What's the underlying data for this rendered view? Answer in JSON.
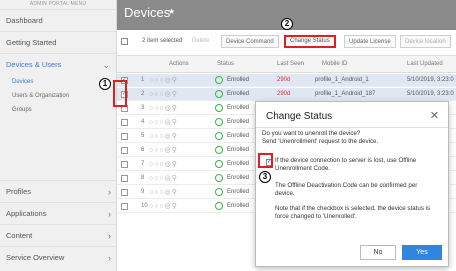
{
  "sidebar": {
    "header": "ADMIN PORTAL MENU",
    "items": [
      {
        "label": "Dashboard",
        "active": false
      },
      {
        "label": "Getting Started",
        "active": false
      },
      {
        "label": "Devices & Users",
        "active": true
      }
    ],
    "subitems": [
      {
        "label": "Devices",
        "active": true
      },
      {
        "label": "Users & Organization",
        "active": false
      },
      {
        "label": "Groups",
        "active": false
      }
    ],
    "bottom_items": [
      {
        "label": "Profiles"
      },
      {
        "label": "Applications"
      },
      {
        "label": "Content"
      },
      {
        "label": "Service Overview"
      }
    ]
  },
  "main": {
    "title": "Devices",
    "toolbar": {
      "selected_text": "2 item selected",
      "delete": "Delete",
      "device_command": "Device Command",
      "change_status": "Change Status",
      "update_license": "Update License",
      "device_location": "Device location"
    },
    "columns": {
      "actions": "Actions",
      "status": "Status",
      "last_seen": "Last Seen",
      "mobile_id": "Mobile ID",
      "last_updated": "Last Updated"
    },
    "rows": [
      {
        "num": "1",
        "status": "Enrolled",
        "last_seen": "290d",
        "mobile_id": "profile_1_Android_1",
        "updated": "5/10/2019, 3:23:0"
      },
      {
        "num": "2",
        "status": "Enrolled",
        "last_seen": "290d",
        "mobile_id": "profile_1_Android_187",
        "updated": "5/10/2019, 3:23:0"
      },
      {
        "num": "3",
        "status": "Enrolled",
        "last_seen": "",
        "mobile_id": "",
        "updated": ""
      },
      {
        "num": "4",
        "status": "Enrolled",
        "last_seen": "",
        "mobile_id": "",
        "updated": ""
      },
      {
        "num": "5",
        "status": "Enrolled",
        "last_seen": "",
        "mobile_id": "",
        "updated": ""
      },
      {
        "num": "6",
        "status": "Enrolled",
        "last_seen": "",
        "mobile_id": "",
        "updated": ""
      },
      {
        "num": "7",
        "status": "Enrolled",
        "last_seen": "",
        "mobile_id": "",
        "updated": ""
      },
      {
        "num": "8",
        "status": "Enrolled",
        "last_seen": "",
        "mobile_id": "",
        "updated": ""
      },
      {
        "num": "9",
        "status": "Enrolled",
        "last_seen": "",
        "mobile_id": "",
        "updated": ""
      },
      {
        "num": "10",
        "status": "Enrolled",
        "last_seen": "",
        "mobile_id": "",
        "updated": ""
      }
    ]
  },
  "modal": {
    "title": "Change Status",
    "question": "Do you want to unenroll the device?",
    "question2": "Send 'Unenrollment' request to the device.",
    "option": "If the device connection to server is lost, use Offline Unenrollment Code.",
    "info1": "The Offline Deactivation Code can be confirmed per device.",
    "info2": "Note that if the checkbox is selected, the device status is force changed to 'Unenrolled'.",
    "no_label": "No",
    "yes_label": "Yes"
  },
  "markers": {
    "m1": "1",
    "m2": "2",
    "m3": "3"
  },
  "colors": {
    "accent": "#2e86de",
    "highlight": "#e02020",
    "enrolled": "#3ab54a"
  }
}
